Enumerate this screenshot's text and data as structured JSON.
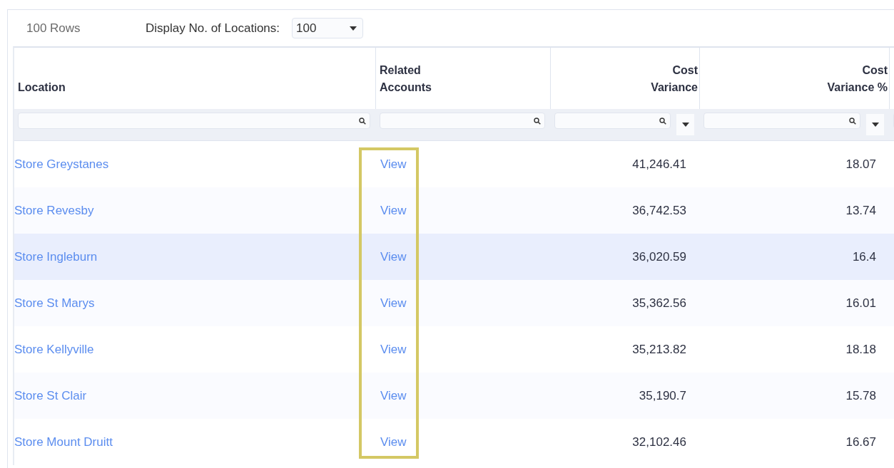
{
  "toolbar": {
    "row_count": "100 Rows",
    "display_label": "Display No. of Locations:",
    "display_value": "100"
  },
  "table": {
    "columns": [
      {
        "label": "Location",
        "kind": "text"
      },
      {
        "label": "Related Accounts",
        "kind": "text"
      },
      {
        "label": "Cost Variance",
        "kind": "number"
      },
      {
        "label": "Cost Variance %",
        "kind": "number"
      }
    ],
    "rows": [
      {
        "location": "Store Greystanes",
        "related": "View",
        "cost_variance": "41,246.41",
        "cost_variance_pct": "18.07",
        "selected": false
      },
      {
        "location": "Store Revesby",
        "related": "View",
        "cost_variance": "36,742.53",
        "cost_variance_pct": "13.74",
        "selected": false
      },
      {
        "location": "Store Ingleburn",
        "related": "View",
        "cost_variance": "36,020.59",
        "cost_variance_pct": "16.4",
        "selected": true
      },
      {
        "location": "Store St Marys",
        "related": "View",
        "cost_variance": "35,362.56",
        "cost_variance_pct": "16.01",
        "selected": false
      },
      {
        "location": "Store Kellyville",
        "related": "View",
        "cost_variance": "35,213.82",
        "cost_variance_pct": "18.18",
        "selected": false
      },
      {
        "location": "Store St Clair",
        "related": "View",
        "cost_variance": "35,190.7",
        "cost_variance_pct": "15.78",
        "selected": false
      },
      {
        "location": "Store Mount Druitt",
        "related": "View",
        "cost_variance": "32,102.46",
        "cost_variance_pct": "16.67",
        "selected": false
      }
    ]
  }
}
